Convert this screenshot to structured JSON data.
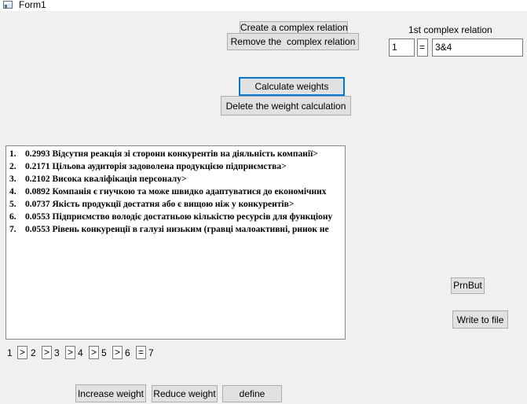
{
  "window": {
    "title": "Form1",
    "icon": "form-app-icon"
  },
  "relation": {
    "create_label": "Create a complex relation",
    "remove_label": "Remove the  complex relation",
    "heading": "1st complex relation",
    "left_value": "1",
    "operator": "=",
    "right_value": "3&4"
  },
  "weights": {
    "calculate_label": "Calculate weights",
    "delete_label": "Delete the weight calculation"
  },
  "results": {
    "items": [
      {
        "num": "1.",
        "text": "0.2993 Відсутня реакція зі сторони конкурентів на діяльність компанії>"
      },
      {
        "num": "2.",
        "text": "0.2171 Цільова аудиторія задоволена продукцією підприємства>"
      },
      {
        "num": "3.",
        "text": "0.2102 Висока кваліфікація персоналу>"
      },
      {
        "num": "4.",
        "text": "0.0892 Компанія є гнучкою та може швидко адаптуватися до економічних"
      },
      {
        "num": "5.",
        "text": "0.0737 Якість продукції достатня або є вищою ніж у конкурентів>"
      },
      {
        "num": "6.",
        "text": "0.0553 Підприємство володіє достатньою кількістю ресурсів для функціону"
      },
      {
        "num": "7.",
        "text": "0.0553 Рівень конкуренції в галузі низьким (гравці малоактивні, ринок не"
      }
    ]
  },
  "ranking": {
    "numbers": [
      "1",
      "2",
      "3",
      "4",
      "5",
      "6",
      "7"
    ],
    "operators": [
      ">",
      ">",
      ">",
      ">",
      ">",
      "="
    ]
  },
  "side": {
    "print_label": "PrnBut",
    "write_label": "Write to file"
  },
  "bottom": {
    "increase_label": "Increase weight",
    "reduce_label": "Reduce weight",
    "define_label": "define"
  }
}
